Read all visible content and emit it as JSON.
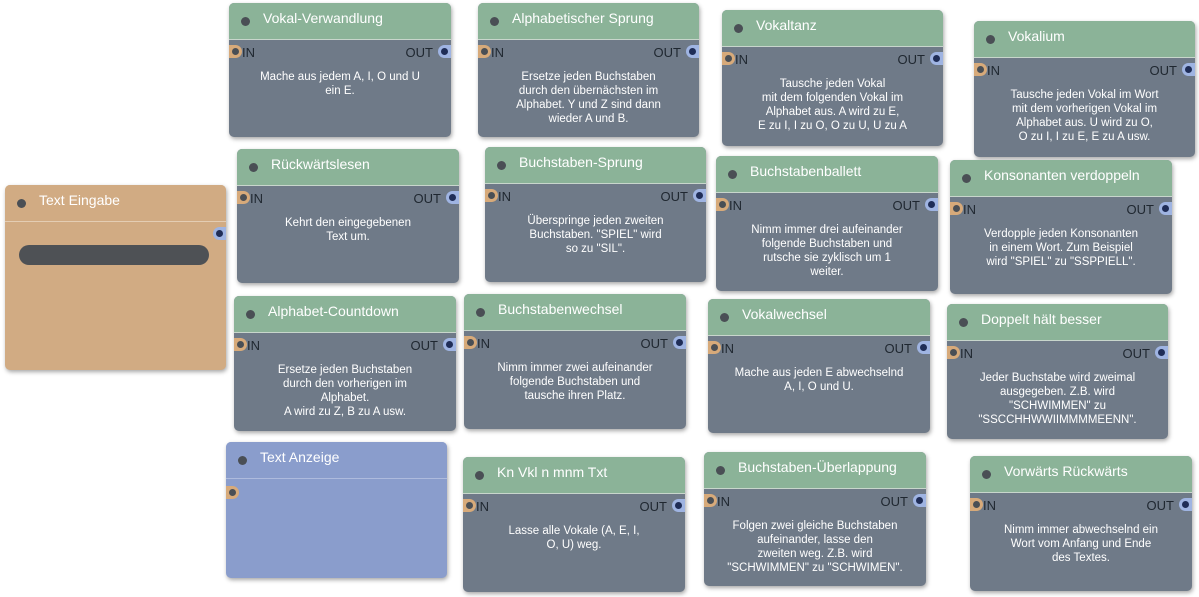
{
  "ports": {
    "in": "IN",
    "out": "OUT"
  },
  "input_node": {
    "title": "Text Eingabe",
    "field_value": ""
  },
  "output_node": {
    "title": "Text Anzeige"
  },
  "nodes": [
    {
      "title": "Vokal-Verwandlung",
      "description": "Mache aus jedem A, I, O und U\nein E."
    },
    {
      "title": "Alphabetischer Sprung",
      "description": "Ersetze jeden Buchstaben\ndurch den übernächsten im\nAlphabet. Y und Z sind dann\nwieder A und B."
    },
    {
      "title": "Vokaltanz",
      "description": "Tausche jeden Vokal\nmit dem folgenden Vokal im\nAlphabet aus. A wird zu E,\nE zu I, I zu O, O zu U, U zu A"
    },
    {
      "title": "Vokalium",
      "description": "Tausche jeden Vokal im Wort\nmit dem vorherigen Vokal im\nAlphabet aus. U wird zu O,\nO zu I, I zu E, E zu A usw."
    },
    {
      "title": "Rückwärtslesen",
      "description": "Kehrt den eingegebenen\nText um."
    },
    {
      "title": "Buchstaben-Sprung",
      "description": "Überspringe jeden zweiten\nBuchstaben. \"SPIEL\" wird\nso zu \"SIL\"."
    },
    {
      "title": "Buchstabenballett",
      "description": "Nimm immer drei aufeinander\nfolgende Buchstaben und\nrutsche sie zyklisch um 1\nweiter."
    },
    {
      "title": "Konsonanten verdoppeln",
      "description": "Verdopple jeden Konsonanten\nin einem Wort. Zum Beispiel\nwird \"SPIEL\" zu \"SSPPIELL\"."
    },
    {
      "title": "Alphabet-Countdown",
      "description": "Ersetze jeden Buchstaben\ndurch den vorherigen im\nAlphabet.\nA wird zu Z, B zu A usw."
    },
    {
      "title": "Buchstabenwechsel",
      "description": "Nimm immer zwei aufeinander\nfolgende Buchstaben und\ntausche ihren Platz."
    },
    {
      "title": "Vokalwechsel",
      "description": "Mache aus jeden E abwechselnd\nA, I, O und U."
    },
    {
      "title": "Doppelt hält besser",
      "description": "Jeder Buchstabe wird zweimal\nausgegeben. Z.B. wird\n\"SCHWIMMEN\" zu\n\"SSCCHHWWIIMMMMEENN\"."
    },
    {
      "title": "Kn Vkl n mnm Txt",
      "description": "Lasse alle Vokale (A, E, I,\nO, U) weg."
    },
    {
      "title": "Buchstaben-Überlappung",
      "description": "Folgen zwei gleiche Buchstaben\naufeinander, lasse den\nzweiten weg. Z.B. wird\n\"SCHWIMMEN\" zu \"SCHWIMEN\"."
    },
    {
      "title": "Vorwärts Rückwärts",
      "description": "Nimm immer abwechselnd ein\nWort vom Anfang und Ende\ndes Textes."
    }
  ]
}
